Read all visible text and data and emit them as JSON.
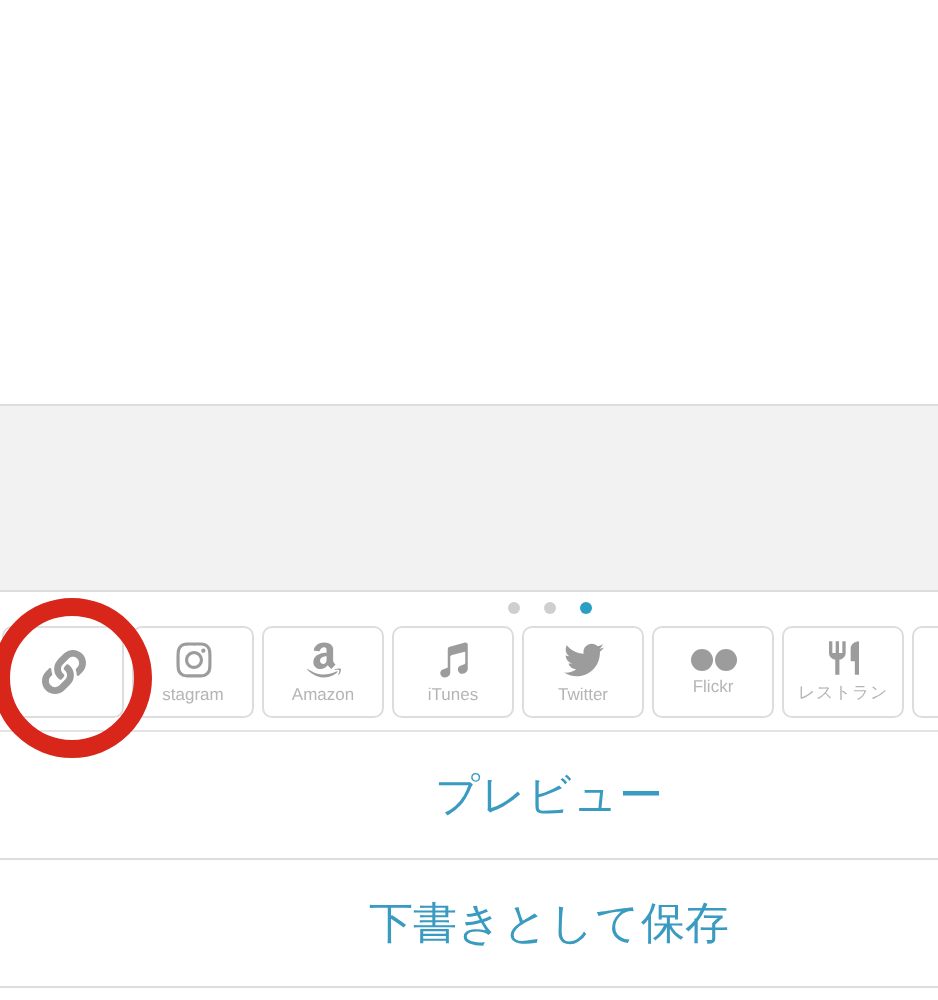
{
  "page_dots": [
    {
      "selected": false
    },
    {
      "selected": false
    },
    {
      "selected": true
    }
  ],
  "embed_tiles": [
    {
      "kind": "link"
    },
    {
      "kind": "instagram",
      "label": "stagram"
    },
    {
      "kind": "amazon",
      "label": "Amazon"
    },
    {
      "kind": "music",
      "label": "iTunes"
    },
    {
      "kind": "bird",
      "label": "Twitter"
    },
    {
      "kind": "dots",
      "label": "Flickr"
    },
    {
      "kind": "restaurant",
      "label": "レストラン"
    },
    {
      "kind": "cut"
    }
  ],
  "annotation": {
    "kind": "circle"
  },
  "actions": [
    "プレビュー",
    "下書きとして保存"
  ]
}
